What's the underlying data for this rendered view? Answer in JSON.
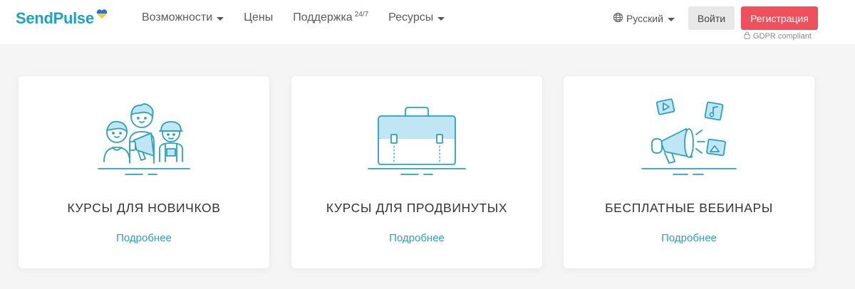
{
  "header": {
    "logo_text": "SendPulse",
    "nav": {
      "features": "Возможности",
      "pricing": "Цены",
      "support": "Поддержка",
      "support_sup": "24/7",
      "resources": "Ресурсы"
    },
    "language": "Русский",
    "login_label": "Войти",
    "register_label": "Регистрация",
    "gdpr_text": "GDPR compliant"
  },
  "cards": [
    {
      "title": "КУРСЫ ДЛЯ НОВИЧКОВ",
      "link": "Подробнее",
      "icon": "people-megaphone-icon"
    },
    {
      "title": "КУРСЫ ДЛЯ ПРОДВИНУТЫХ",
      "link": "Подробнее",
      "icon": "briefcase-icon"
    },
    {
      "title": "БЕСПЛАТНЫЕ ВЕБИНАРЫ",
      "link": "Подробнее",
      "icon": "megaphone-media-icon"
    }
  ],
  "colors": {
    "brand": "#1aa3c4",
    "accent_red": "#f0505b",
    "link": "#2ba1b7",
    "illustration_fill": "#bfe6f2"
  }
}
